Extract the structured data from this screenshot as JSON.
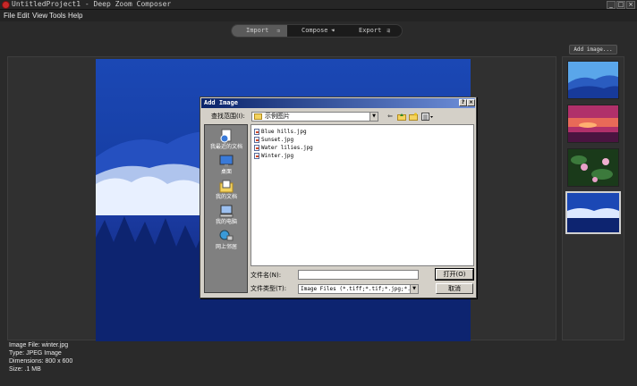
{
  "window": {
    "title": "UntitledProject1 - Deep Zoom Composer",
    "minimize": "_",
    "maximize": "□",
    "close": "×"
  },
  "menu": {
    "file": "File",
    "edit": "Edit",
    "view": "View",
    "tools": "Tools",
    "help": "Help"
  },
  "modes": {
    "import": "Import",
    "compose": "Compose",
    "export": "Export"
  },
  "add_image_button": "Add image...",
  "info": {
    "file": "Image File: winter.jpg",
    "type": "Type: JPEG Image",
    "dimensions": "Dimensions: 800 x 600",
    "size": "Size: .1 MB"
  },
  "dialog": {
    "title": "Add Image",
    "help": "?",
    "close": "×",
    "look_in_label": "查找范围(I):",
    "look_in_value": "示例图片",
    "places": [
      "我最近的文档",
      "桌面",
      "我的文档",
      "我的电脑",
      "网上邻居"
    ],
    "files": [
      "Blue hills.jpg",
      "Sunset.jpg",
      "Water lilies.jpg",
      "Winter.jpg"
    ],
    "filename_label": "文件名(N):",
    "filename_value": "",
    "filetype_label": "文件类型(T):",
    "filetype_value": "Image Files (*.tiff;*.tif;*.jpg;*.bmp",
    "open": "打开(O)",
    "cancel": "取消"
  },
  "colors": {
    "accent": "#0a246a",
    "selected_tab": "#5a5a5a",
    "preview_sky": "#173a9a"
  }
}
